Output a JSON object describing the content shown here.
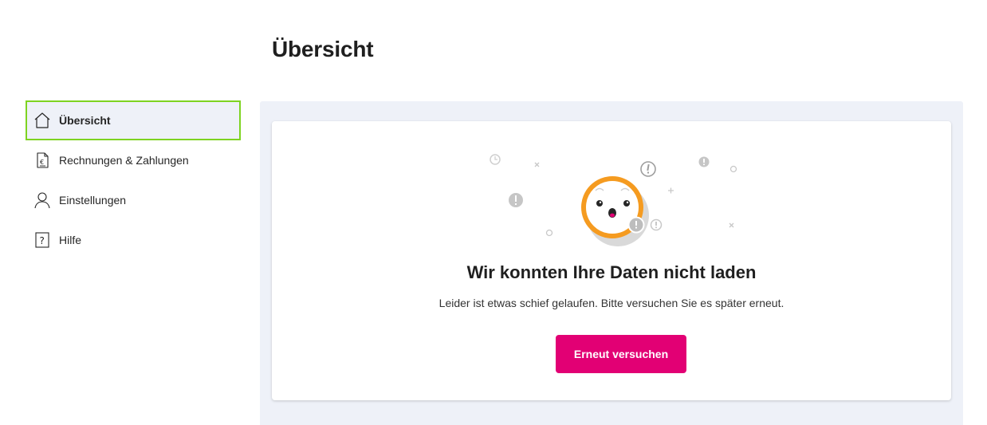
{
  "page": {
    "title": "Übersicht"
  },
  "sidebar": {
    "items": [
      {
        "label": "Übersicht",
        "icon": "home-icon",
        "active": true
      },
      {
        "label": "Rechnungen & Zahlungen",
        "icon": "invoice-euro-icon",
        "active": false
      },
      {
        "label": "Einstellungen",
        "icon": "user-icon",
        "active": false
      },
      {
        "label": "Hilfe",
        "icon": "help-icon",
        "active": false
      }
    ]
  },
  "error": {
    "title": "Wir konnten Ihre Daten nicht laden",
    "message": "Leider ist etwas schief gelaufen. Bitte versuchen Sie es später erneut.",
    "retry_label": "Erneut versuchen",
    "illustration": "error-face-illustration"
  },
  "colors": {
    "brand_magenta": "#e20074",
    "active_outline": "#7ed321",
    "panel_background": "#eef1f8",
    "face_ring": "#f59b20"
  }
}
